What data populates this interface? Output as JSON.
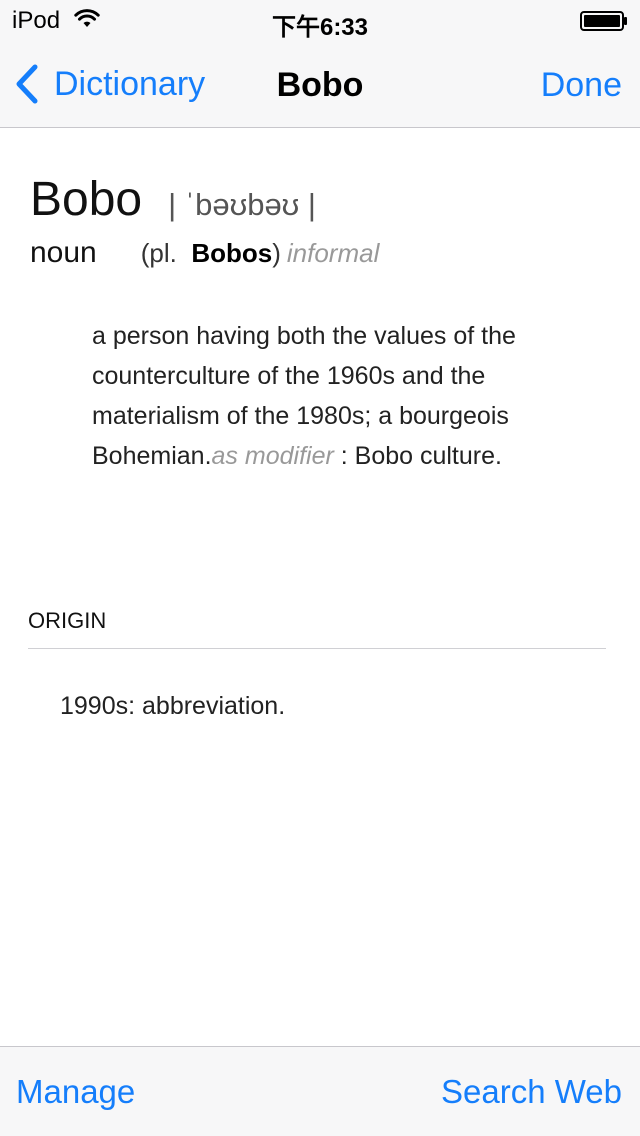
{
  "status_bar": {
    "carrier": "iPod",
    "time": "下午6:33"
  },
  "nav": {
    "back_label": "Dictionary",
    "title": "Bobo",
    "done_label": "Done"
  },
  "entry": {
    "headword": "Bobo",
    "pronunciation": "| ˈbəʊbəʊ |",
    "part_of_speech": "noun",
    "plural_prefix": "(pl.",
    "plural_form": "Bobos",
    "plural_suffix": ")",
    "register": "informal",
    "definition_main": "a person having both the values of the counterculture of the 1960s and the materialism of the 1980s; a bourgeois Bohemian.",
    "modifier_label": "as modifier",
    "example": ": Bobo culture."
  },
  "origin": {
    "label": "ORIGIN",
    "text": "1990s: abbreviation."
  },
  "toolbar": {
    "manage_label": "Manage",
    "search_web_label": "Search Web"
  },
  "colors": {
    "accent": "#157efb",
    "bar_background": "#f7f7f8",
    "muted_text": "#999999"
  },
  "icons": {
    "wifi": "wifi-icon",
    "battery": "battery-icon",
    "back": "chevron-left-icon"
  }
}
